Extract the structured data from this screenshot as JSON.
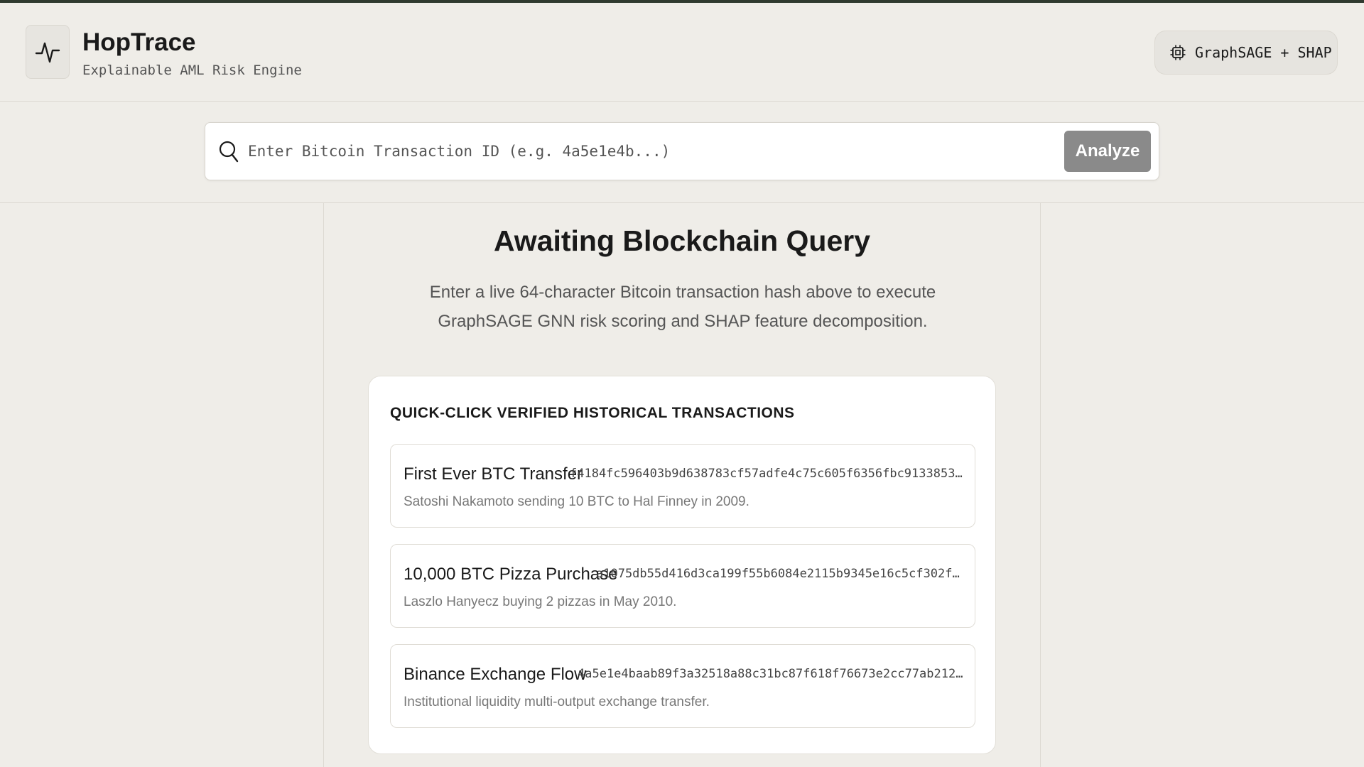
{
  "header": {
    "brand": "HopTrace",
    "tagline": "Explainable AML Risk Engine",
    "model_chip": "GraphSAGE + SHAP"
  },
  "search": {
    "placeholder": "Enter Bitcoin Transaction ID (e.g. 4a5e1e4b...)",
    "value": "",
    "button_label": "Analyze"
  },
  "main": {
    "title": "Awaiting Blockchain Query",
    "description": "Enter a live 64-character Bitcoin transaction hash above to execute GraphSAGE GNN risk scoring and SHAP feature decomposition."
  },
  "quick_click": {
    "heading": "QUICK-CLICK VERIFIED HISTORICAL TRANSACTIONS",
    "items": [
      {
        "title": "First Ever BTC Transfer",
        "hash": "f4184fc596403b9d638783cf57adfe4c75c605f6356fbc91338530...",
        "description": "Satoshi Nakamoto sending 10 BTC to Hal Finney in 2009."
      },
      {
        "title": "10,000 BTC Pizza Purchase",
        "hash": "a1075db55d416d3ca199f55b6084e2115b9345e16c5cf302fc8...",
        "description": "Laszlo Hanyecz buying 2 pizzas in May 2010."
      },
      {
        "title": "Binance Exchange Flow",
        "hash": "4a5e1e4baab89f3a32518a88c31bc87f618f76673e2cc77ab2127...",
        "description": "Institutional liquidity multi-output exchange transfer."
      }
    ]
  },
  "icons": {
    "logo": "activity-pulse-icon",
    "model_chip": "cpu-chip-icon",
    "search": "search-icon"
  }
}
